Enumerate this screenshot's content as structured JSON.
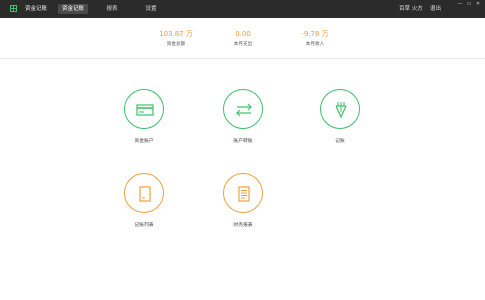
{
  "app": {
    "title": "资金记账"
  },
  "nav": {
    "tabs": [
      {
        "label": "资金记账"
      },
      {
        "label": "报表"
      },
      {
        "label": "设置"
      }
    ]
  },
  "user": {
    "name": "百草 火方",
    "logout": "退出"
  },
  "window": {
    "minimize": "—",
    "restore": "▭",
    "close": "✕"
  },
  "summary": [
    {
      "value": "103.87 万",
      "label": "资金总额"
    },
    {
      "value": "0.00",
      "label": "本月支出"
    },
    {
      "value": "-9.78 万",
      "label": "本月收入"
    }
  ],
  "tiles": [
    {
      "label": "资金账户",
      "icon": "card-icon",
      "color": "#3cc16a"
    },
    {
      "label": "账户转账",
      "icon": "transfer-arrows-icon",
      "color": "#3cc16a"
    },
    {
      "label": "记账",
      "icon": "pen-nib-icon",
      "color": "#3cc16a"
    },
    {
      "label": "记账列表",
      "icon": "list-document-icon",
      "color": "#f0a040"
    },
    {
      "label": "财务报表",
      "icon": "report-document-icon",
      "color": "#f0a040"
    }
  ],
  "colors": {
    "titlebar": "#2b2b2b",
    "accent_green": "#3cc16a",
    "accent_orange": "#f0a040",
    "stat_value": "#f29b3b"
  }
}
